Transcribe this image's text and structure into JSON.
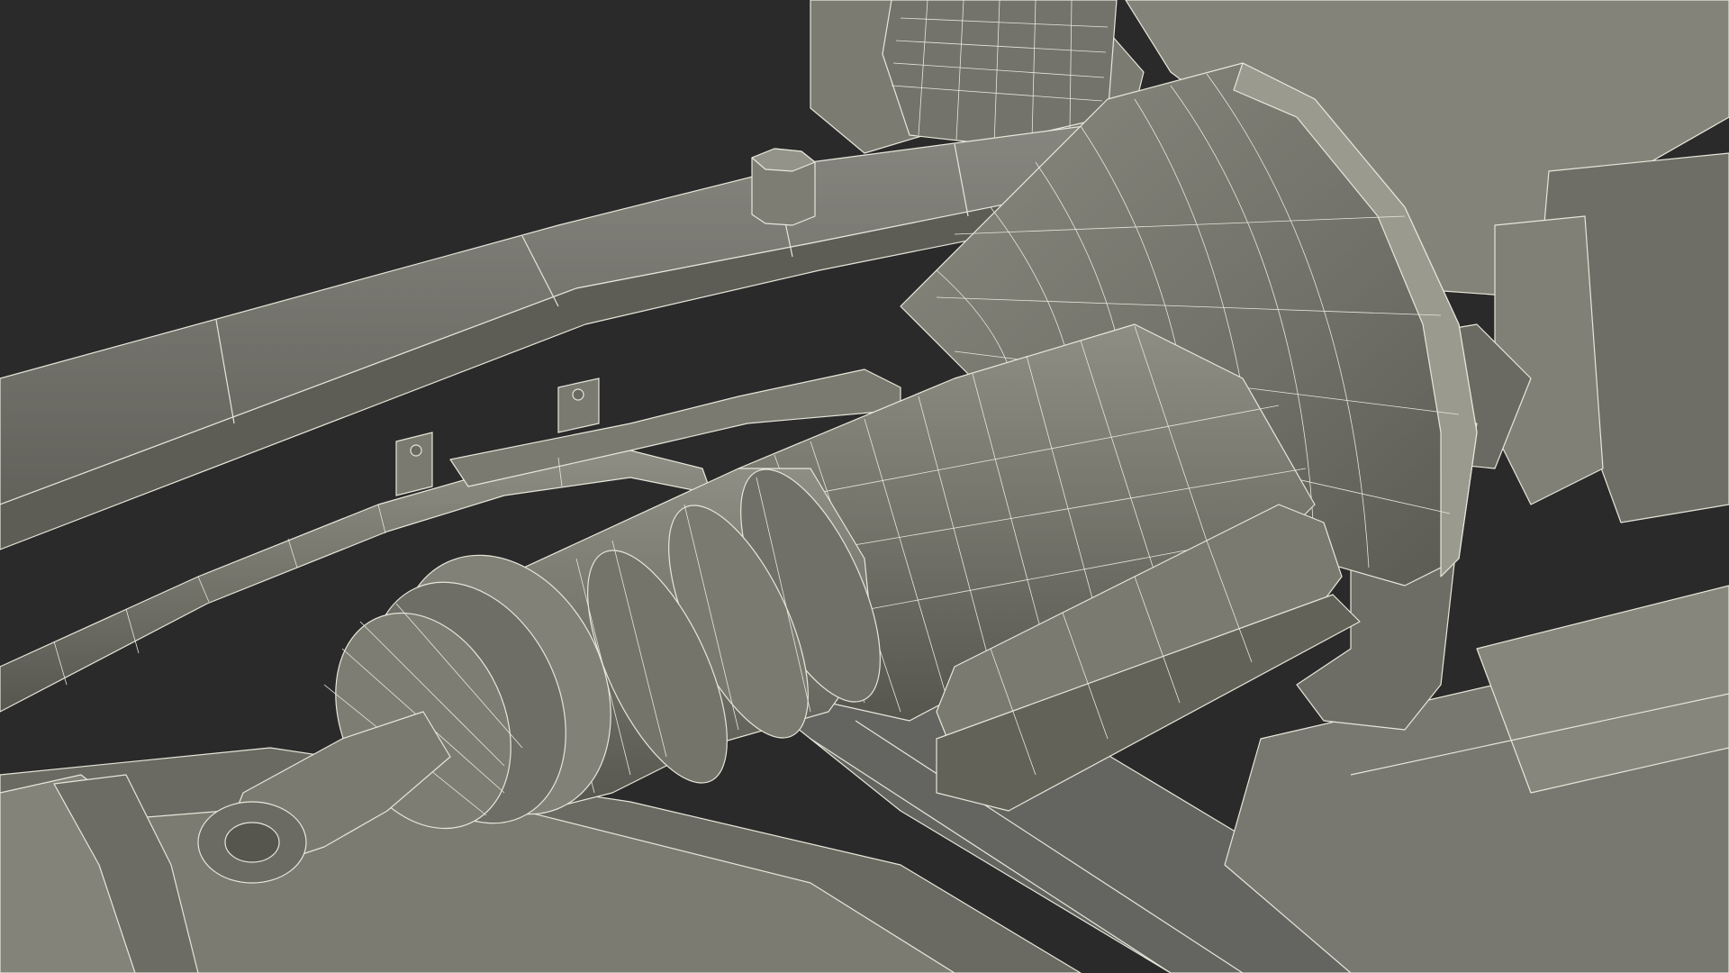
{
  "viewport": {
    "label": "",
    "background_color": "#2a2a2a"
  },
  "scene": {
    "subject": "wireframe-vehicle-chassis-transmission",
    "colors": {
      "surface": "#7a7a70",
      "surface_light": "#8c8c82",
      "surface_dark": "#5c5c54",
      "wire": "#e8e8dc",
      "background": "#2a2a2a"
    }
  }
}
